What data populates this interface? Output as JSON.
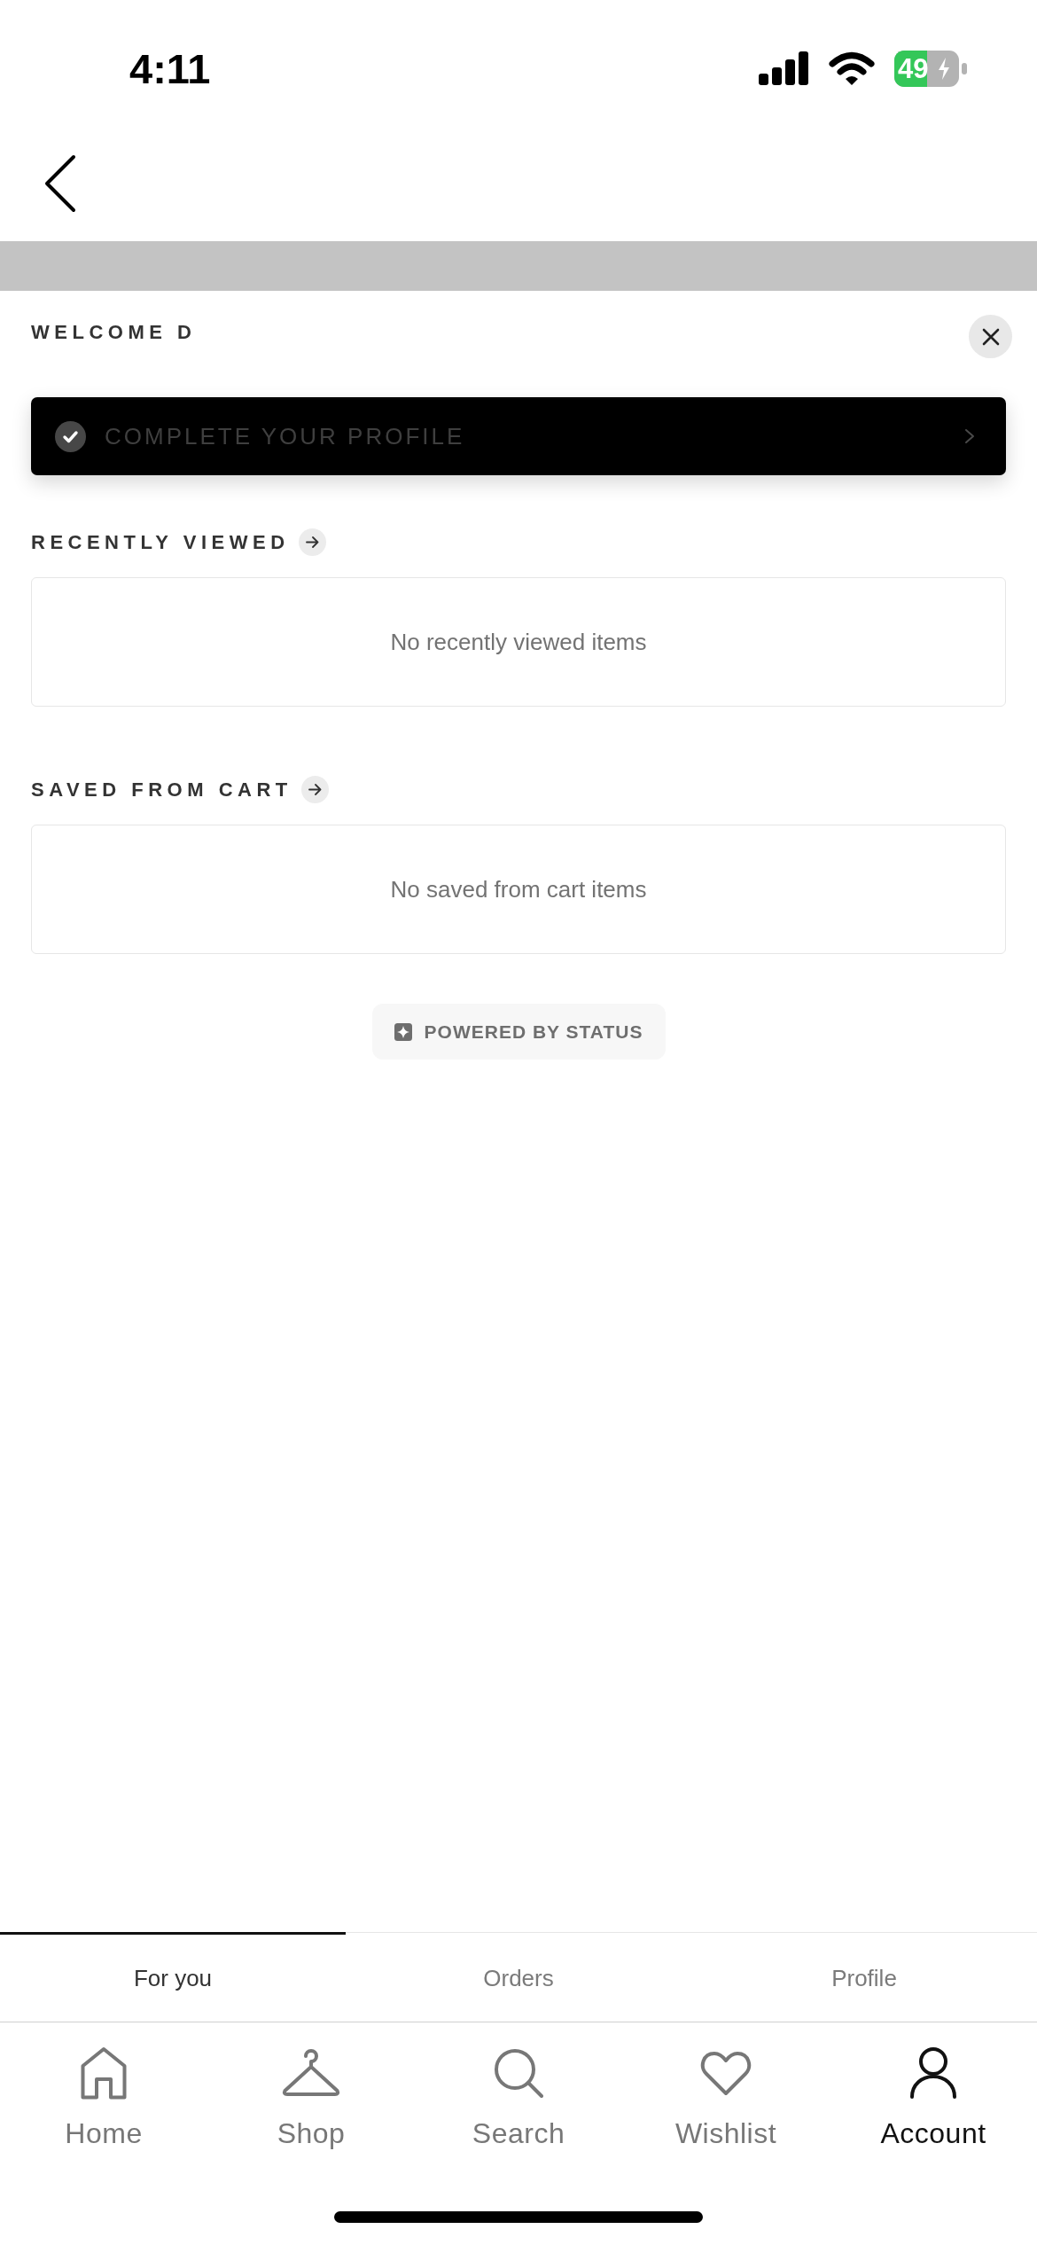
{
  "status_bar": {
    "time": "4:11",
    "battery_text": "49"
  },
  "sheet": {
    "title": "WELCOME D",
    "profile_prompt": "COMPLETE YOUR PROFILE",
    "sections": [
      {
        "title": "RECENTLY VIEWED",
        "empty_message": "No recently viewed items"
      },
      {
        "title": "SAVED FROM CART",
        "empty_message": "No saved from cart items"
      }
    ],
    "powered_by": "POWERED BY STATUS"
  },
  "tabs": [
    {
      "label": "For you",
      "selected": true
    },
    {
      "label": "Orders",
      "selected": false
    },
    {
      "label": "Profile",
      "selected": false
    }
  ],
  "nav": [
    {
      "label": "Home",
      "kind": "home",
      "selected": false
    },
    {
      "label": "Shop",
      "kind": "hanger",
      "selected": false
    },
    {
      "label": "Search",
      "kind": "search",
      "selected": false
    },
    {
      "label": "Wishlist",
      "kind": "heart",
      "selected": false
    },
    {
      "label": "Account",
      "kind": "person",
      "selected": true
    }
  ]
}
